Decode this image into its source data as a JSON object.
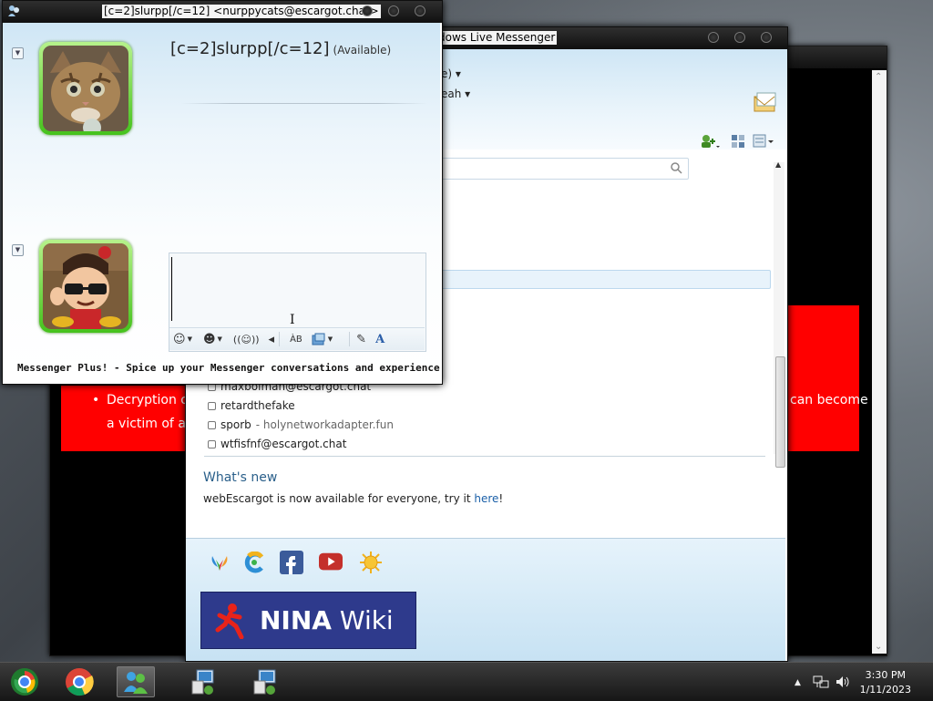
{
  "conversation": {
    "title": "[c=2]slurpp[/c=12] <nurppycats@escargot.chat>",
    "contact_name": "[c=2]slurpp[/c=12]",
    "contact_status": "(Available)",
    "plus_banner": "Messenger Plus! - Spice up your Messenger conversations and experience w...",
    "toolbar": [
      "emoticons-icon",
      "winks-icon",
      "nudge-icon",
      "voice-clip-icon",
      "font-icon",
      "backgrounds-icon",
      "handwriting-icon",
      "text-format-icon"
    ]
  },
  "messenger": {
    "title": "Windows Live Messenger",
    "title_visible": "dows Live Messenger",
    "status_fragment": "e) ▾",
    "psm_fragment": "eah ▾",
    "contacts": [
      {
        "name": "maxbolman@escargot.chat",
        "psm": ""
      },
      {
        "name": "retardthefake",
        "psm": ""
      },
      {
        "name": "sporb",
        "psm": "- holynetworkadapter.fun"
      },
      {
        "name": "wtfisfnf@escargot.chat",
        "psm": ""
      }
    ],
    "whats_new": {
      "heading": "What's new",
      "text_before": "webEscargot is now available for everyone, try it ",
      "link": "here",
      "text_after": "!"
    },
    "services": [
      "messenger-butterfly-icon",
      "escargot-icon",
      "facebook-icon",
      "youtube-icon",
      "sun-icon"
    ],
    "banner": {
      "bold": "NINA",
      "normal": " Wiki"
    }
  },
  "background_page": {
    "bullet_line1": "Decryption of",
    "bullet_line2": "a victim of a",
    "right_fragment": "can become"
  },
  "taskbar": {
    "time": "3:30 PM",
    "date": "1/11/2023"
  }
}
